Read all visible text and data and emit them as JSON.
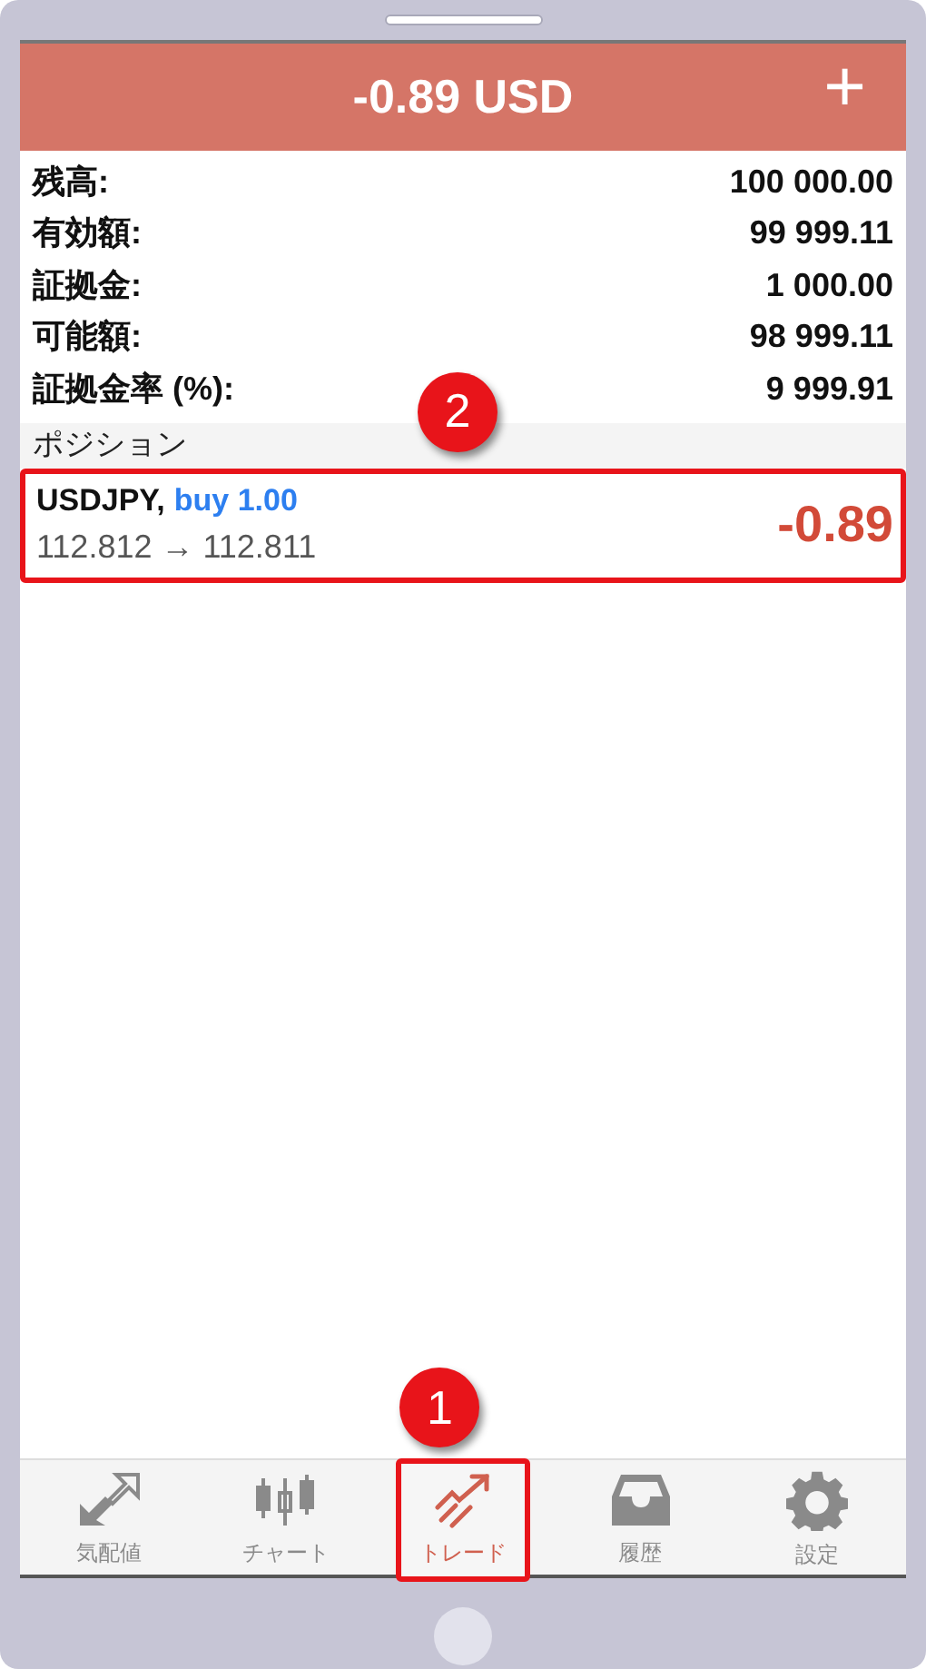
{
  "header": {
    "title": "-0.89 USD",
    "add_button": "+"
  },
  "account": [
    {
      "label": "残高:",
      "value": "100 000.00"
    },
    {
      "label": "有効額:",
      "value": "99 999.11"
    },
    {
      "label": "証拠金:",
      "value": "1 000.00"
    },
    {
      "label": "可能額:",
      "value": "98 999.11"
    },
    {
      "label": "証拠金率 (%):",
      "value": "9 999.91"
    }
  ],
  "positions_header": "ポジション",
  "positions": [
    {
      "symbol": "USDJPY,",
      "side": "buy 1.00",
      "prices": "112.812 → 112.811",
      "profit": "-0.89",
      "highlighted": true,
      "callout": "2"
    }
  ],
  "tabs": [
    {
      "label": "気配値",
      "kind": "quotes",
      "selected": false,
      "highlighted": false
    },
    {
      "label": "チャート",
      "kind": "chart",
      "selected": false,
      "highlighted": false
    },
    {
      "label": "トレード",
      "kind": "trade",
      "selected": true,
      "highlighted": true,
      "callout": "1"
    },
    {
      "label": "履歴",
      "kind": "history",
      "selected": false,
      "highlighted": false
    },
    {
      "label": "設定",
      "kind": "settings",
      "selected": false,
      "highlighted": false
    }
  ]
}
